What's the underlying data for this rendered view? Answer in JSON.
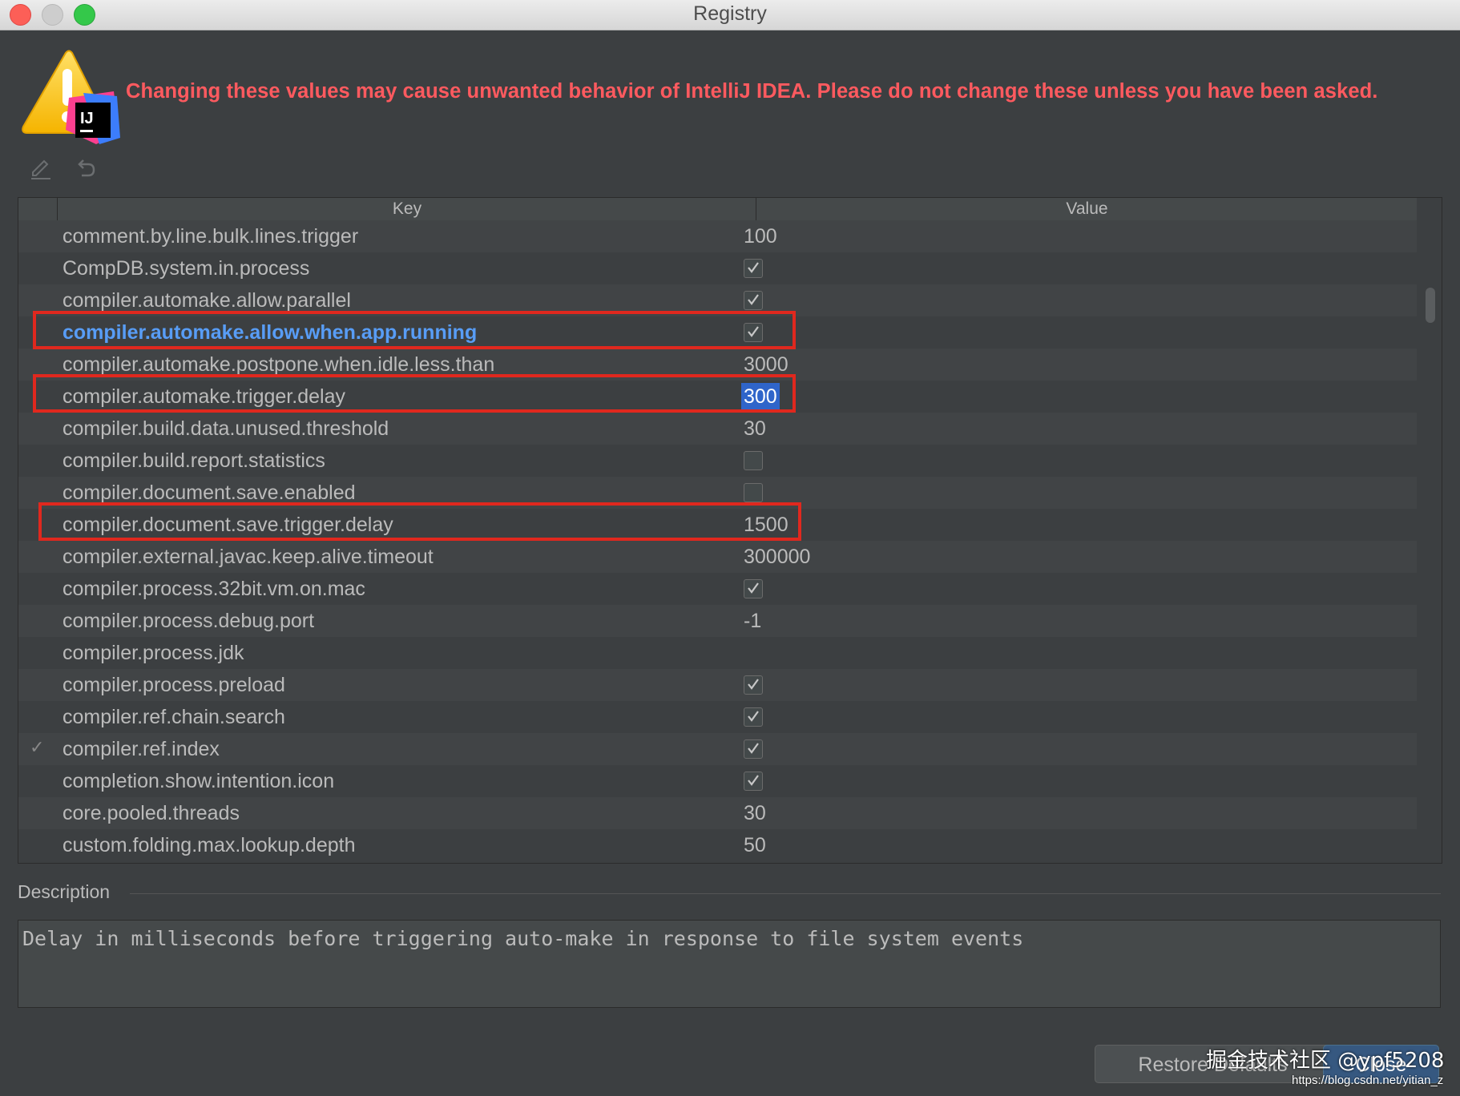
{
  "window": {
    "title": "Registry"
  },
  "warning": {
    "text": "Changing these values may cause unwanted behavior of IntelliJ IDEA. Please do not change these unless you have been asked."
  },
  "toolbar": {
    "edit_icon": "pencil-icon",
    "revert_icon": "undo-icon"
  },
  "table": {
    "headers": {
      "key": "Key",
      "value": "Value"
    },
    "rows": [
      {
        "key": "comment.by.line.bulk.lines.trigger",
        "value": "100",
        "type": "text"
      },
      {
        "key": "CompDB.system.in.process",
        "value": "",
        "type": "checkbox",
        "checked": true
      },
      {
        "key": "compiler.automake.allow.parallel",
        "value": "",
        "type": "checkbox",
        "checked": true
      },
      {
        "key": "compiler.automake.allow.when.app.running",
        "value": "",
        "type": "checkbox",
        "checked": true,
        "modified": true,
        "highlighted": true
      },
      {
        "key": "compiler.automake.postpone.when.idle.less.than",
        "value": "3000",
        "type": "text"
      },
      {
        "key": "compiler.automake.trigger.delay",
        "value": "300",
        "type": "text",
        "selected": true,
        "highlighted": true
      },
      {
        "key": "compiler.build.data.unused.threshold",
        "value": "30",
        "type": "text"
      },
      {
        "key": "compiler.build.report.statistics",
        "value": "",
        "type": "checkbox",
        "checked": false
      },
      {
        "key": "compiler.document.save.enabled",
        "value": "",
        "type": "checkbox",
        "checked": false
      },
      {
        "key": "compiler.document.save.trigger.delay",
        "value": "1500",
        "type": "text",
        "highlighted": true
      },
      {
        "key": "compiler.external.javac.keep.alive.timeout",
        "value": "300000",
        "type": "text"
      },
      {
        "key": "compiler.process.32bit.vm.on.mac",
        "value": "",
        "type": "checkbox",
        "checked": true
      },
      {
        "key": "compiler.process.debug.port",
        "value": "-1",
        "type": "text"
      },
      {
        "key": "compiler.process.jdk",
        "value": "",
        "type": "text"
      },
      {
        "key": "compiler.process.preload",
        "value": "",
        "type": "checkbox",
        "checked": true
      },
      {
        "key": "compiler.ref.chain.search",
        "value": "",
        "type": "checkbox",
        "checked": true
      },
      {
        "key": "compiler.ref.index",
        "value": "",
        "type": "checkbox",
        "checked": true,
        "mark": "✓"
      },
      {
        "key": "completion.show.intention.icon",
        "value": "",
        "type": "checkbox",
        "checked": true
      },
      {
        "key": "core.pooled.threads",
        "value": "30",
        "type": "text"
      },
      {
        "key": "custom.folding.max.lookup.depth",
        "value": "50",
        "type": "text"
      }
    ]
  },
  "description": {
    "label": "Description",
    "text": "Delay in milliseconds before triggering auto-make in response to file system events"
  },
  "buttons": {
    "restore": "Restore Defaults",
    "close": "Close"
  },
  "watermark": {
    "text": "掘金技术社区 @ypf5208",
    "url": "https://blog.csdn.net/yitian_z"
  },
  "colors": {
    "warning": "#ff5a5f",
    "modified_key": "#589df6",
    "selection": "#2f65ca",
    "highlight_box": "#e0281e",
    "background": "#3c3f41"
  }
}
